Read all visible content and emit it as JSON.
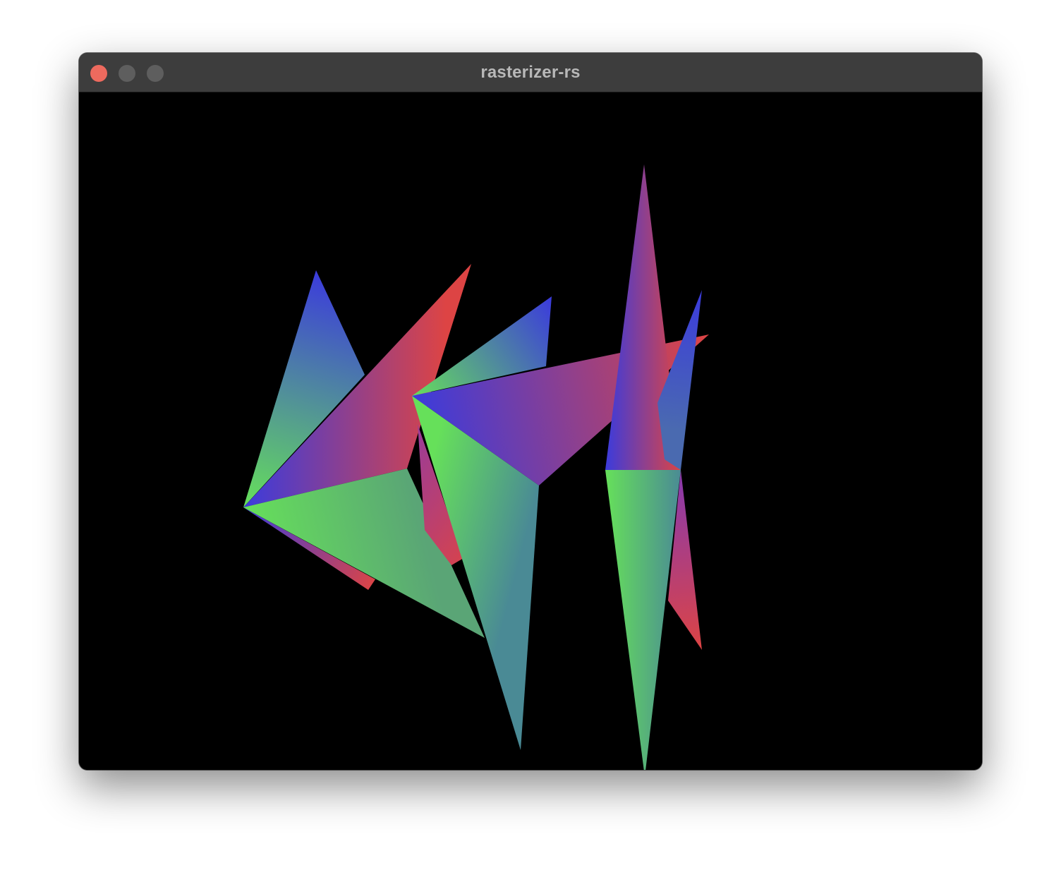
{
  "window": {
    "title": "rasterizer-rs",
    "buttons": [
      {
        "name": "close",
        "color": "#ed6a5e"
      },
      {
        "name": "minimize",
        "color": "#5e5e5e"
      },
      {
        "name": "zoom",
        "color": "#5e5e5e"
      }
    ]
  },
  "viewport": {
    "background": "#000000",
    "vertex_colors": {
      "red": "#dd4444",
      "green": "#66e05a",
      "blue": "#3b3bdc"
    }
  }
}
